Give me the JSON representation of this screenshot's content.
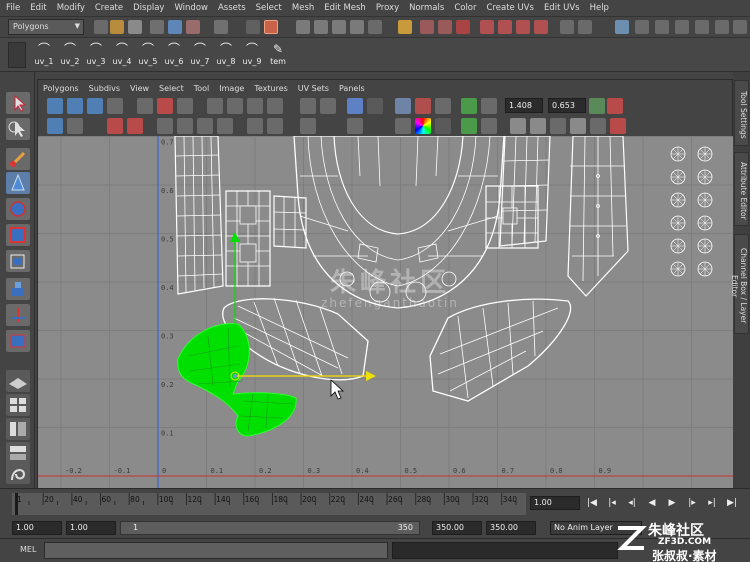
{
  "menubar": [
    "File",
    "Edit",
    "Modify",
    "Create",
    "Display",
    "Window",
    "Assets",
    "Select",
    "Mesh",
    "Edit Mesh",
    "Proxy",
    "Normals",
    "Color",
    "Create UVs",
    "Edit UVs",
    "Help"
  ],
  "status": {
    "mode": "Polygons"
  },
  "shelf": {
    "buttons": [
      "uv_1",
      "uv_2",
      "uv_3",
      "uv_4",
      "uv_5",
      "uv_6",
      "uv_7",
      "uv_8",
      "uv_9",
      "tem"
    ]
  },
  "uv_editor": {
    "menus": [
      "Polygons",
      "Subdivs",
      "View",
      "Select",
      "Tool",
      "Image",
      "Textures",
      "UV Sets",
      "Panels"
    ],
    "field1": "1.408",
    "field2": "0.653",
    "grid_v_labels": [
      "0.8",
      "0.7",
      "0.6",
      "0.5",
      "0.4",
      "0.3",
      "0.2",
      "0.1"
    ],
    "grid_u_labels": [
      "-0.2",
      "-0.1",
      "0",
      "0.1",
      "0.2",
      "0.3",
      "0.4",
      "0.5",
      "0.6",
      "0.7",
      "0.8",
      "0.9"
    ]
  },
  "right_tabs": [
    "Tool Settings",
    "Attribute Editor",
    "Channel Box / Layer Editor"
  ],
  "timeline": {
    "ticks": [
      "1",
      "20",
      "40",
      "60",
      "80",
      "100",
      "120",
      "140",
      "160",
      "180",
      "200",
      "220",
      "240",
      "260",
      "280",
      "300",
      "320",
      "340"
    ],
    "current": "1.00"
  },
  "range": {
    "start": "1.00",
    "start2": "1.00",
    "slider_start": "1",
    "slider_end": "350",
    "end": "350.00",
    "end2": "350.00",
    "anim_layer": "No Anim Layer"
  },
  "command": {
    "label": "MEL"
  },
  "watermark": {
    "center": "朱峰社区",
    "center_url": "zhefenganthaotin",
    "brand_top": "朱峰社区",
    "brand_url": "ZF3D.COM",
    "brand_bottom": "张叔叔·素材"
  },
  "colors": {
    "accent_select": "#00e000",
    "manip_yellow": "#f0e000",
    "manip_green": "#00e000",
    "uv_bg": "#8b8b8b"
  }
}
